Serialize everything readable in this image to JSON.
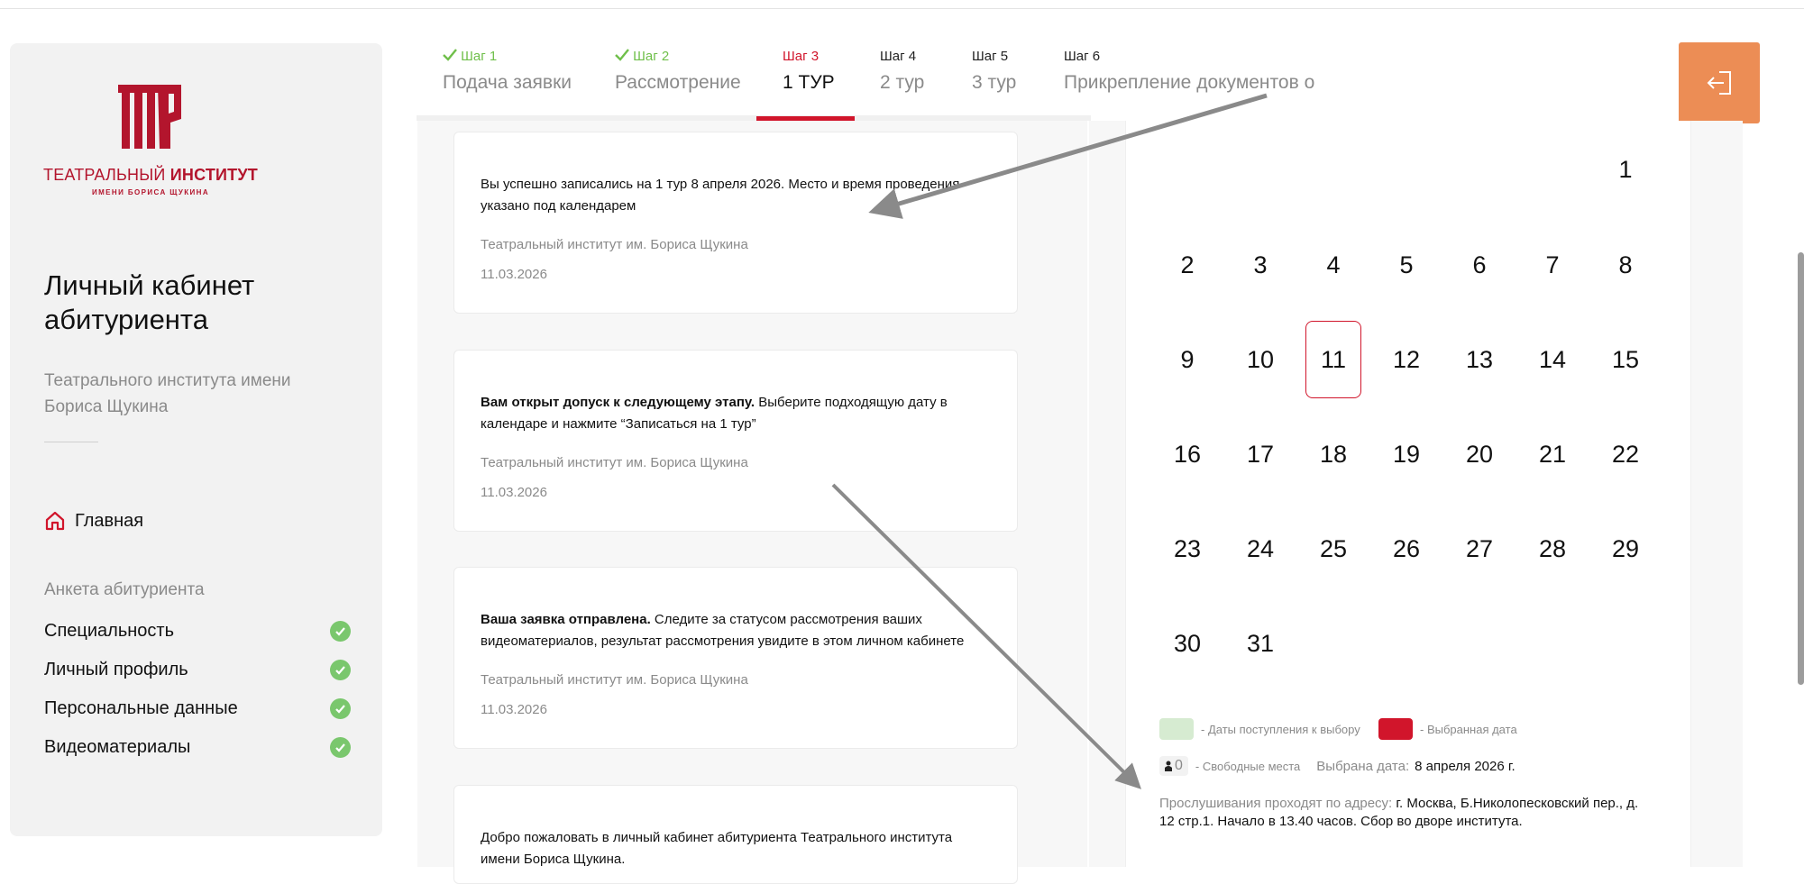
{
  "sidebar": {
    "logo": {
      "line1_a": "ТЕАТРАЛЬНЫЙ ",
      "line1_b": "ИНСТИТУТ",
      "line2": "ИМЕНИ БОРИСА ЩУКИНА"
    },
    "title": "Личный кабинет абитуриента",
    "subtitle": "Театрального института имени Бориса Щукина",
    "home_label": "Главная",
    "section_label": "Анкета абитуриента",
    "items": [
      {
        "label": "Специальность",
        "status": "complete"
      },
      {
        "label": "Личный профиль",
        "status": "complete"
      },
      {
        "label": "Персональные данные",
        "status": "complete"
      },
      {
        "label": "Видеоматериалы",
        "status": "complete"
      }
    ]
  },
  "steps": [
    {
      "num": "Шаг 1",
      "label": "Подача заявки",
      "state": "done"
    },
    {
      "num": "Шаг 2",
      "label": "Рассмотрение",
      "state": "done"
    },
    {
      "num": "Шаг 3",
      "label": "1 ТУР",
      "state": "active"
    },
    {
      "num": "Шаг 4",
      "label": "2 тур",
      "state": "pending"
    },
    {
      "num": "Шаг 5",
      "label": "3 тур",
      "state": "pending"
    },
    {
      "num": "Шаг 6",
      "label": "Прикрепление документов о",
      "state": "pending"
    }
  ],
  "messages": [
    {
      "bold": "",
      "text": "Вы успешно записались на 1 тур 8 апреля 2026. Место и время проведения указано под календарем",
      "sender": "Театральный институт им. Бориса Щукина",
      "date": "11.03.2026"
    },
    {
      "bold": "Вам открыт допуск к следующему этапу.",
      "text": " Выберите подходящую дату в календаре и нажмите “Записаться на 1 тур”",
      "sender": "Театральный институт им. Бориса Щукина",
      "date": "11.03.2026"
    },
    {
      "bold": "Ваша заявка отправлена.",
      "text": " Следите за статусом рассмотрения ваших видеоматериалов, результат рассмотрения увидите в этом личном кабинете",
      "sender": "Театральный институт им. Бориса Щукина",
      "date": "11.03.2026"
    },
    {
      "bold": "",
      "text": "Добро пожаловать в личный кабинет абитуриента Театрального института имени Бориса Щукина.",
      "sender": "",
      "date": ""
    }
  ],
  "calendar": {
    "days": [
      "1",
      "2",
      "3",
      "4",
      "5",
      "6",
      "7",
      "8",
      "9",
      "10",
      "11",
      "12",
      "13",
      "14",
      "15",
      "16",
      "17",
      "18",
      "19",
      "20",
      "21",
      "22",
      "23",
      "24",
      "25",
      "26",
      "27",
      "28",
      "29",
      "30",
      "31"
    ],
    "first_weekday_index": 6,
    "selected_day": "11",
    "legend": {
      "available": "- Даты поступления к выбору",
      "selected": "- Выбранная дата",
      "seats_count": "0",
      "seats": "- Свободные места",
      "chosen_prefix": "Выбрана дата:",
      "chosen_value": "8 апреля 2026 г."
    },
    "address_prefix": "Прослушивания проходят по адресу:",
    "address": " г. Москва, Б.Николопесковский пер., д. 12 стр.1. Начало в 13.40 часов. Сбор во дворе института."
  },
  "colors": {
    "accent": "#d1152b",
    "done": "#6fbf4a",
    "logout": "#ec8d55",
    "available": "#d6ebd1"
  }
}
